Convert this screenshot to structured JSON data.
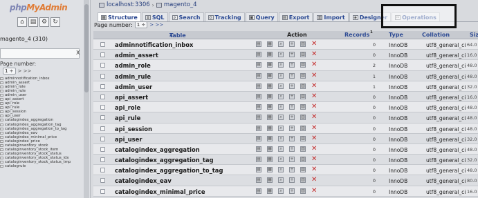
{
  "sidebar": {
    "logo": {
      "php": "php",
      "my": "My",
      "admin": "Admin"
    },
    "icons": [
      "home-icon",
      "docs-icon",
      "settings-icon",
      "reload-icon"
    ],
    "icon_glyphs": [
      "⌂",
      "▤",
      "⚙",
      "↻"
    ],
    "db_label": "magento_4 (310)",
    "filter_value": "",
    "filter_clear": "X",
    "page_number_label": "Page number:",
    "page_select": "1 ÷",
    "page_arrows": "> >>",
    "tables": [
      "adminnotification_inbox",
      "admin_assert",
      "admin_role",
      "admin_rule",
      "admin_user",
      "api_assert",
      "api_role",
      "api_rule",
      "api_session",
      "api_user",
      "catalogindex_aggregation",
      "catalogindex_aggregation_tag",
      "catalogindex_aggregation_to_tag",
      "catalogindex_eav",
      "catalogindex_minimal_price",
      "catalogindex_price",
      "cataloginventory_stock",
      "cataloginventory_stock_item",
      "cataloginventory_stock_status",
      "cataloginventory_stock_status_idx",
      "cataloginventory_stock_status_tmp",
      "catalogrule"
    ]
  },
  "breadcrumb": {
    "server": "localhost:3306",
    "separator": "›",
    "database": "magento_4"
  },
  "tabs": [
    {
      "label": "Structure",
      "icon": "structure-icon",
      "glyph": "▦",
      "active": true
    },
    {
      "label": "SQL",
      "icon": "sql-icon",
      "glyph": "≡",
      "active": false
    },
    {
      "label": "Search",
      "icon": "search-icon",
      "glyph": "⌕",
      "active": false
    },
    {
      "label": "Tracking",
      "icon": "tracking-icon",
      "glyph": "◎",
      "active": false
    },
    {
      "label": "Query",
      "icon": "query-icon",
      "glyph": "▣",
      "active": false
    },
    {
      "label": "Export",
      "icon": "export-icon",
      "glyph": "▤",
      "active": false
    },
    {
      "label": "Import",
      "icon": "import-icon",
      "glyph": "▥",
      "active": false
    },
    {
      "label": "Designer",
      "icon": "designer-icon",
      "glyph": "◈",
      "active": false
    },
    {
      "label": "Operations",
      "icon": "operations-icon",
      "glyph": "✂",
      "active": false
    }
  ],
  "pager": {
    "label": "Page number:",
    "value": "1 ÷",
    "arrows": "> >>"
  },
  "table": {
    "headers": {
      "table": "Table",
      "sort": "▲",
      "action": "Action",
      "records": "Records",
      "records_sup": "1",
      "type": "Type",
      "collation": "Collation",
      "size": "Siz"
    },
    "action_icons": [
      "browse-icon",
      "structure-icon",
      "search-icon",
      "insert-icon",
      "empty-icon",
      "drop-icon"
    ],
    "rows": [
      {
        "name": "adminnotification_inbox",
        "records": "0",
        "type": "InnoDB",
        "collation": "utf8_general_ci",
        "size": "64.0"
      },
      {
        "name": "admin_assert",
        "records": "0",
        "type": "InnoDB",
        "collation": "utf8_general_ci",
        "size": "16.0"
      },
      {
        "name": "admin_role",
        "records": "2",
        "type": "InnoDB",
        "collation": "utf8_general_ci",
        "size": "48.0"
      },
      {
        "name": "admin_rule",
        "records": "1",
        "type": "InnoDB",
        "collation": "utf8_general_ci",
        "size": "48.0"
      },
      {
        "name": "admin_user",
        "records": "1",
        "type": "InnoDB",
        "collation": "utf8_general_ci",
        "size": "32.0"
      },
      {
        "name": "api_assert",
        "records": "0",
        "type": "InnoDB",
        "collation": "utf8_general_ci",
        "size": "16.0"
      },
      {
        "name": "api_role",
        "records": "0",
        "type": "InnoDB",
        "collation": "utf8_general_ci",
        "size": "48.0"
      },
      {
        "name": "api_rule",
        "records": "0",
        "type": "InnoDB",
        "collation": "utf8_general_ci",
        "size": "48.0"
      },
      {
        "name": "api_session",
        "records": "0",
        "type": "InnoDB",
        "collation": "utf8_general_ci",
        "size": "48.0"
      },
      {
        "name": "api_user",
        "records": "0",
        "type": "InnoDB",
        "collation": "utf8_general_ci",
        "size": "32.0"
      },
      {
        "name": "catalogindex_aggregation",
        "records": "0",
        "type": "InnoDB",
        "collation": "utf8_general_ci",
        "size": "48.0"
      },
      {
        "name": "catalogindex_aggregation_tag",
        "records": "0",
        "type": "InnoDB",
        "collation": "utf8_general_ci",
        "size": "32.0"
      },
      {
        "name": "catalogindex_aggregation_to_tag",
        "records": "0",
        "type": "InnoDB",
        "collation": "utf8_general_ci",
        "size": "48.0"
      },
      {
        "name": "catalogindex_eav",
        "records": "0",
        "type": "InnoDB",
        "collation": "utf8_general_ci",
        "size": "80.0"
      },
      {
        "name": "catalogindex_minimal_price",
        "records": "0",
        "type": "InnoDB",
        "collation": "utf8_general_ci",
        "size": "16.0"
      }
    ]
  },
  "colors": {
    "highlight_border": "#111111",
    "link_blue": "#27499b",
    "drop_red": "#d12a2a",
    "logo_orange": "#e97a2c"
  }
}
